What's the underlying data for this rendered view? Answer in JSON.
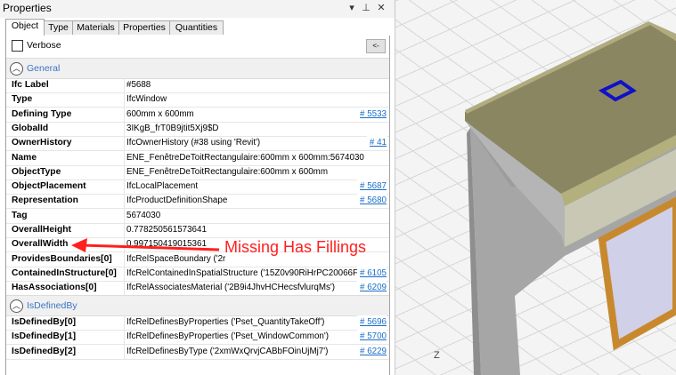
{
  "window": {
    "title": "Properties",
    "pin_glyph": "▾",
    "dock_glyph": "⊥",
    "close_glyph": "✕"
  },
  "tabs": [
    {
      "label": "Object"
    },
    {
      "label": "Type"
    },
    {
      "label": "Materials"
    },
    {
      "label": "Properties"
    },
    {
      "label": "Quantities"
    }
  ],
  "verbose": {
    "label": "Verbose",
    "checked": false,
    "back_label": "<-"
  },
  "groups": {
    "general": {
      "label": "General",
      "rows": [
        {
          "name": "Ifc Label",
          "value": "#5688",
          "link": ""
        },
        {
          "name": "Type",
          "value": "IfcWindow",
          "link": ""
        },
        {
          "name": "Defining Type",
          "value": "600mm x 600mm",
          "link": "# 5533"
        },
        {
          "name": "GlobalId",
          "value": "3IKgB_frT0B9jtit5Xj9$D",
          "link": ""
        },
        {
          "name": "OwnerHistory",
          "value": "IfcOwnerHistory (#38 using 'Revit')",
          "link": "# 41"
        },
        {
          "name": "Name",
          "value": "ENE_FenêtreDeToitRectangulaire:600mm x 600mm:5674030",
          "link": ""
        },
        {
          "name": "ObjectType",
          "value": "ENE_FenêtreDeToitRectangulaire:600mm x 600mm",
          "link": ""
        },
        {
          "name": "ObjectPlacement",
          "value": "IfcLocalPlacement",
          "link": "# 5687"
        },
        {
          "name": "Representation",
          "value": "IfcProductDefinitionShape",
          "link": "# 5680"
        },
        {
          "name": "Tag",
          "value": "5674030",
          "link": ""
        },
        {
          "name": "OverallHeight",
          "value": "0.778250561573641",
          "link": ""
        },
        {
          "name": "OverallWidth",
          "value": "0.997150419015361",
          "link": ""
        },
        {
          "name": "ProvidesBoundaries[0]",
          "value": "IfcRelSpaceBoundary ('2r",
          "link": ""
        },
        {
          "name": "ContainedInStructure[0]",
          "value": "IfcRelContainedInSpatialStructure ('15Z0v90RiHrPC20066Fc",
          "link": "# 6105"
        },
        {
          "name": "HasAssociations[0]",
          "value": "IfcRelAssociatesMaterial ('2B9i4JhvHCHecsfvlurqMs')",
          "link": "# 6209"
        }
      ]
    },
    "defined_by": {
      "label": "IsDefinedBy",
      "rows": [
        {
          "name": "IsDefinedBy[0]",
          "value": "IfcRelDefinesByProperties ('Pset_QuantityTakeOff')",
          "link": "# 5696"
        },
        {
          "name": "IsDefinedBy[1]",
          "value": "IfcRelDefinesByProperties ('Pset_WindowCommon')",
          "link": "# 5700"
        },
        {
          "name": "IsDefinedBy[2]",
          "value": "IfcRelDefinesByType ('2xmWxQrvjCABbFOinUjMj7')",
          "link": "# 6229"
        }
      ]
    }
  },
  "annotation": {
    "text": "Missing Has Fillings",
    "color": "#ff1f1f"
  },
  "viewport": {
    "axis_label": "Z"
  },
  "colors": {
    "link": "#1a6ec7",
    "group_label": "#3b74c4",
    "selection": "#1010c8",
    "window_frame": "#c8892e"
  }
}
